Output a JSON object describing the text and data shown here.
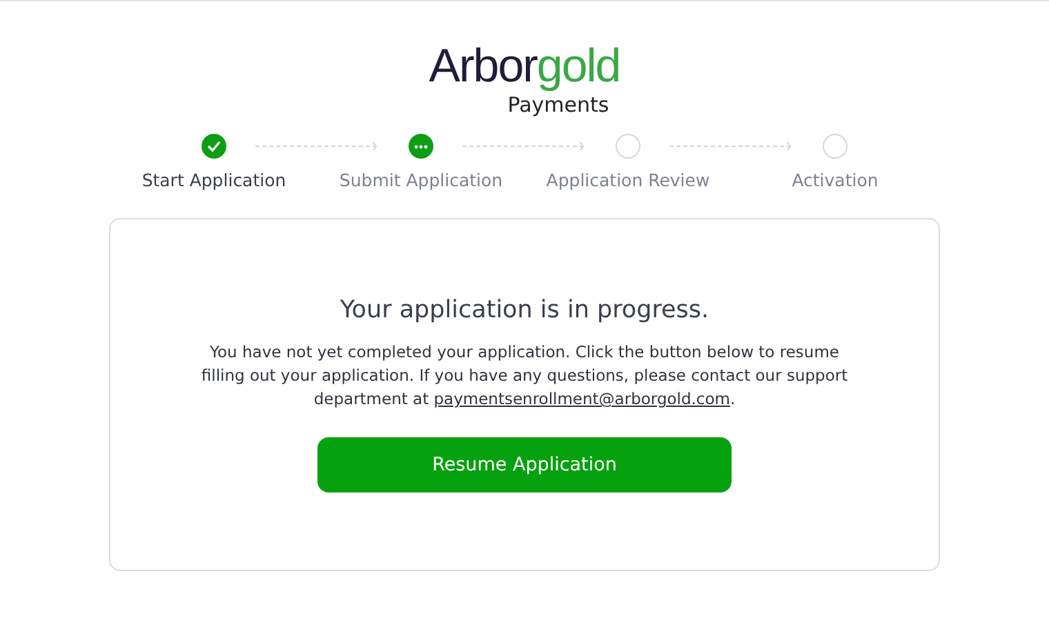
{
  "logo": {
    "brand_dark": "Arbor",
    "brand_green": "gold",
    "subtitle": "Payments"
  },
  "steps": [
    {
      "label": "Start Application",
      "kind": "done"
    },
    {
      "label": "Submit Application",
      "kind": "current"
    },
    {
      "label": "Application Review",
      "kind": "pending"
    },
    {
      "label": "Activation",
      "kind": "pending"
    }
  ],
  "card": {
    "title": "Your application is in progress.",
    "message_before": "You have not yet completed your application. Click the button below to resume filling out your application. If you have any questions, please contact our support department at ",
    "email_link": "paymentsenrollment@arborgold.com",
    "message_after": ".",
    "button": "Resume Application"
  }
}
